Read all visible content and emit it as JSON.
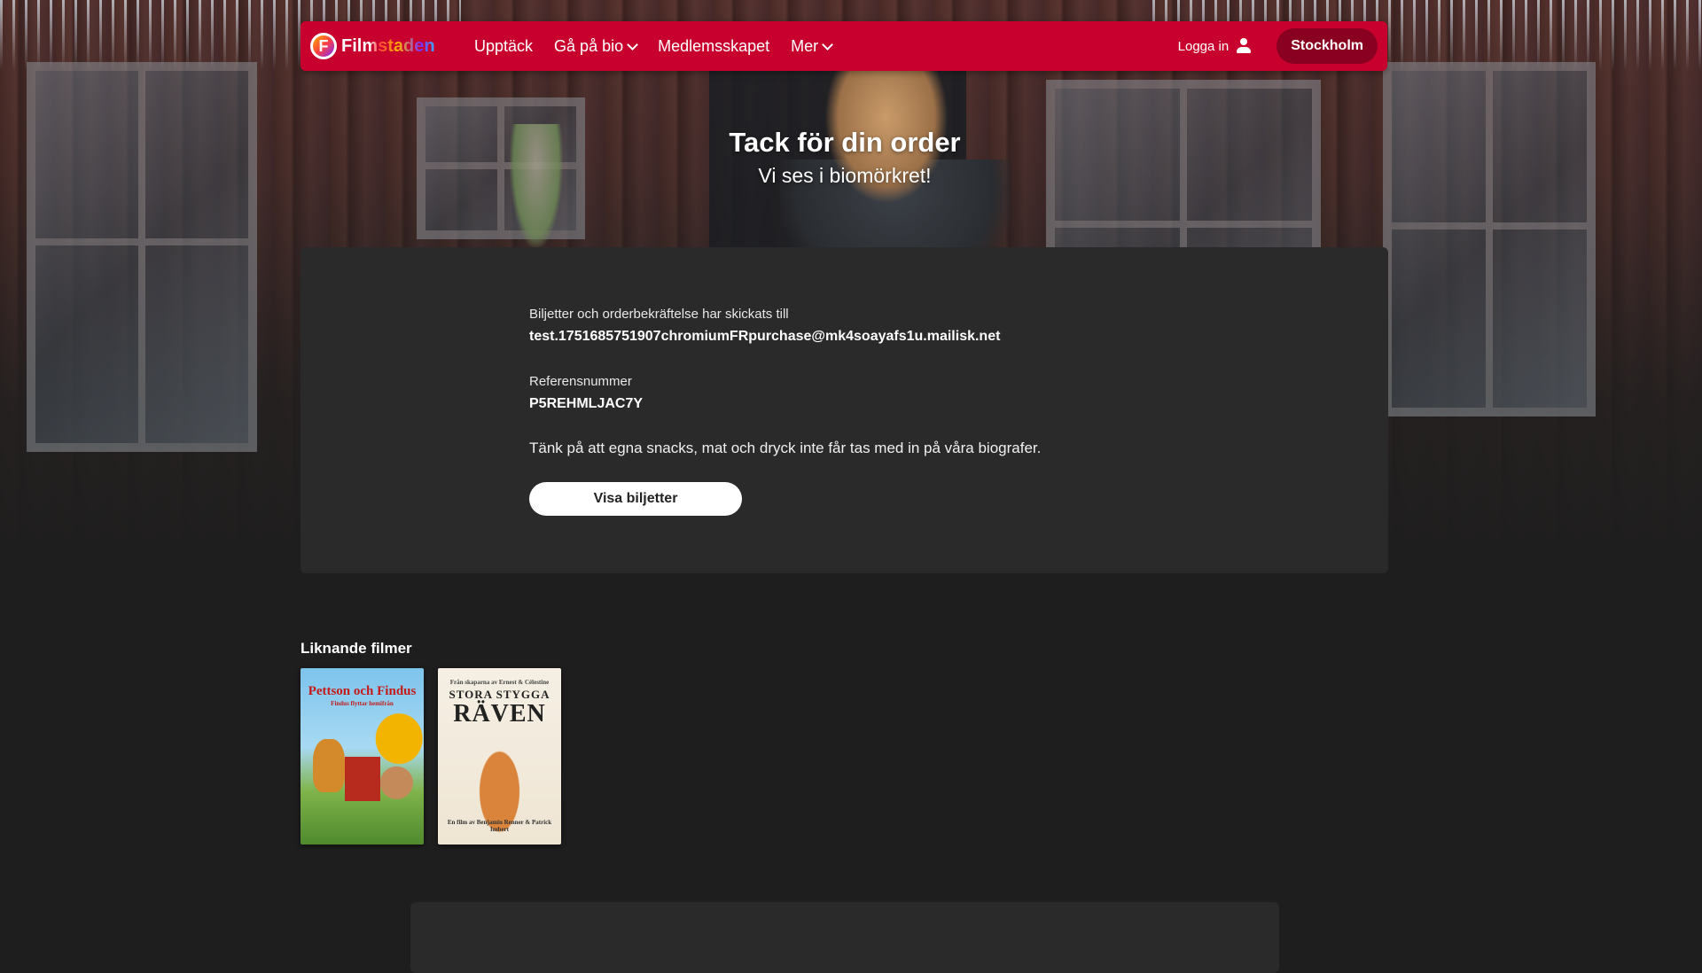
{
  "nav": {
    "logo_letter": "F",
    "logo_text": "Filmstaden",
    "links": [
      {
        "label": "Upptäck",
        "has_dropdown": false
      },
      {
        "label": "Gå på bio",
        "has_dropdown": true
      },
      {
        "label": "Medlemsskapet",
        "has_dropdown": false
      },
      {
        "label": "Mer",
        "has_dropdown": true
      }
    ],
    "login_label": "Logga in",
    "city_label": "Stockholm",
    "brand_color": "#c8002d"
  },
  "hero": {
    "title": "Tack för din order",
    "subtitle": "Vi ses i biomörkret!"
  },
  "confirmation": {
    "sent_to_label": "Biljetter och orderbekräftelse har skickats till",
    "email": "test.1751685751907chromiumFRpurchase@mk4soayafs1u.mailisk.net",
    "reference_label": "Referensnummer",
    "reference_number": "P5REHMLJAC7Y",
    "notice": "Tänk på att egna snacks, mat och dryck inte får tas med in på våra biografer.",
    "button_label": "Visa biljetter"
  },
  "similar": {
    "title": "Liknande filmer",
    "posters": [
      {
        "title": "Pettson och Findus",
        "subtitle": "Findus flyttar hemifrån"
      },
      {
        "pre": "Från skaparna av Ernest & Célestine",
        "title_line1": "STORA STYGGA",
        "title_line2": "RÄVEN",
        "credit": "En film av Benjamin Renner & Patrick Imbert"
      }
    ]
  }
}
